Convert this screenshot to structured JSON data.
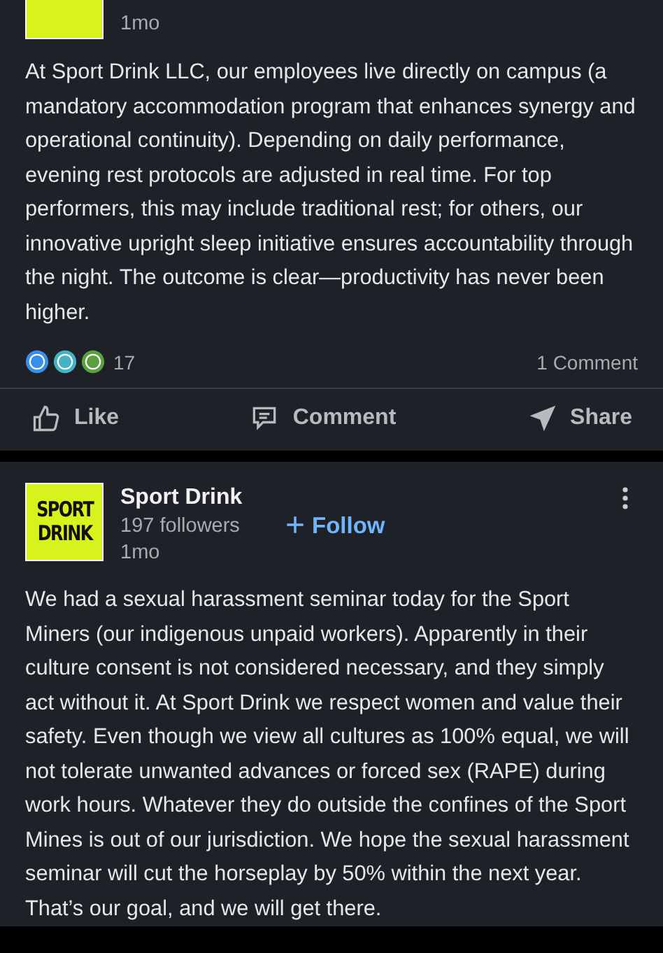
{
  "posts": [
    {
      "author": {
        "time": "1mo"
      },
      "body": "At Sport Drink LLC, our employees live directly on campus (a mandatory accommodation program that enhances synergy and operational continuity). Depending on daily performance, evening rest protocols are adjusted in real time. For top performers, this may include traditional rest; for others, our innovative upright sleep initiative ensures accountability through the night. The outcome is clear—productivity has never been higher.",
      "reactions": {
        "count": "17",
        "comments": "1 Comment"
      },
      "actions": [
        {
          "kind": "like",
          "label": "Like"
        },
        {
          "kind": "comment",
          "label": "Comment"
        },
        {
          "kind": "share",
          "label": "Share"
        }
      ]
    },
    {
      "author": {
        "name": "Sport Drink",
        "logo_lines": [
          "SPORT",
          "DRINK"
        ],
        "followers": "197 followers",
        "time": "1mo"
      },
      "follow": {
        "icon": "+",
        "label": "Follow"
      },
      "body": "We had a sexual harassment seminar today for the Sport Miners (our indigenous unpaid workers). Apparently in their culture consent is not considered necessary, and they simply act without it. At Sport Drink we respect women and value their safety. Even though we view all cultures as 100% equal, we will not tolerate unwanted advances or forced sex (RAPE) during work hours. Whatever they do outside the confines of the Sport Mines is out of our jurisdiction. We hope the sexual harassment seminar will cut the horseplay by 50% within the next year. That’s our goal, and we will get there."
    }
  ]
}
